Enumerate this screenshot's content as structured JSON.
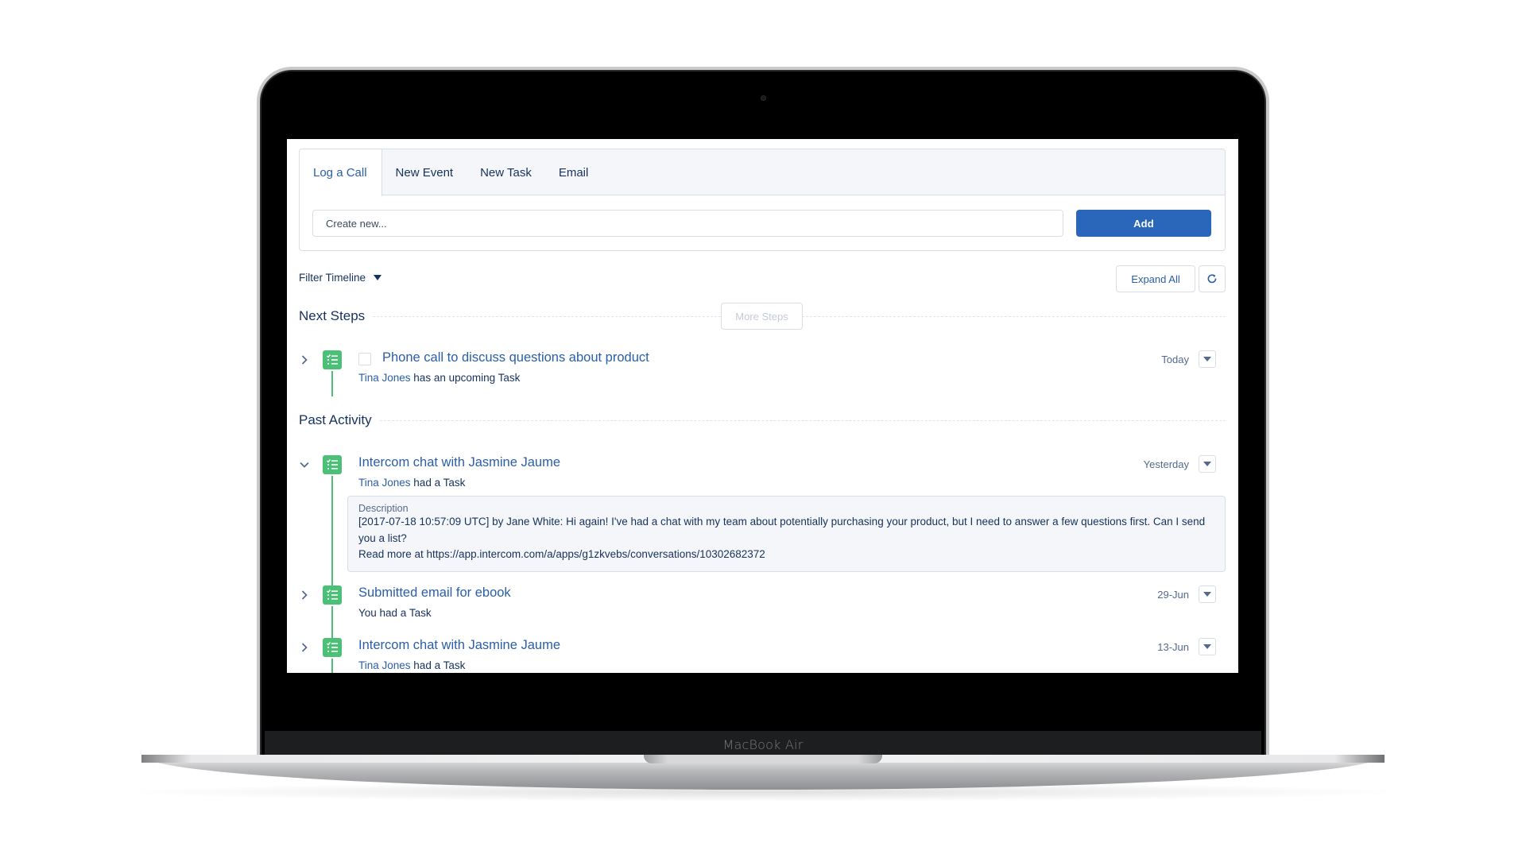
{
  "device": {
    "label": "MacBook Air"
  },
  "composer": {
    "tabs": [
      {
        "label": "Log a Call",
        "active": true
      },
      {
        "label": "New Event",
        "active": false
      },
      {
        "label": "New Task",
        "active": false
      },
      {
        "label": "Email",
        "active": false
      }
    ],
    "input_placeholder": "Create new...",
    "input_value": "",
    "add_label": "Add"
  },
  "toolbar": {
    "filter_label": "Filter Timeline",
    "expand_all_label": "Expand All",
    "refresh_icon": "refresh-icon"
  },
  "next_steps": {
    "title": "Next Steps",
    "more_steps_label": "More Steps",
    "items": [
      {
        "expanded": false,
        "icon": "task-icon",
        "has_checkbox": true,
        "checked": false,
        "title": "Phone call to discuss questions about product",
        "who": "Tina Jones",
        "action": " has an upcoming Task",
        "date": "Today"
      }
    ]
  },
  "past_activity": {
    "title": "Past Activity",
    "items": [
      {
        "expanded": true,
        "icon": "task-icon",
        "title": "Intercom chat with Jasmine Jaume",
        "who": "Tina Jones",
        "action": " had a Task",
        "date": "Yesterday",
        "description_label": "Description",
        "description": "[2017-07-18 10:57:09 UTC] by Jane White: Hi again! I've had a chat with my team about potentially purchasing your product, but I need to answer a few questions first. Can I send you a list?\n Read more at https://app.intercom.com/a/apps/g1zkvebs/conversations/10302682372"
      },
      {
        "expanded": false,
        "icon": "task-icon",
        "title": "Submitted email for ebook",
        "who": "",
        "action": "You had a Task",
        "date": "29-Jun"
      },
      {
        "expanded": false,
        "icon": "task-icon",
        "title": "Intercom chat with Jasmine Jaume",
        "who": "Tina Jones",
        "action": " had a Task",
        "date": "13-Jun"
      }
    ]
  },
  "colors": {
    "brand_blue": "#2a66b9",
    "link_blue": "#2a5ea8",
    "task_green": "#4bc076",
    "text_dark": "#16325c",
    "border": "#d8dde6"
  }
}
